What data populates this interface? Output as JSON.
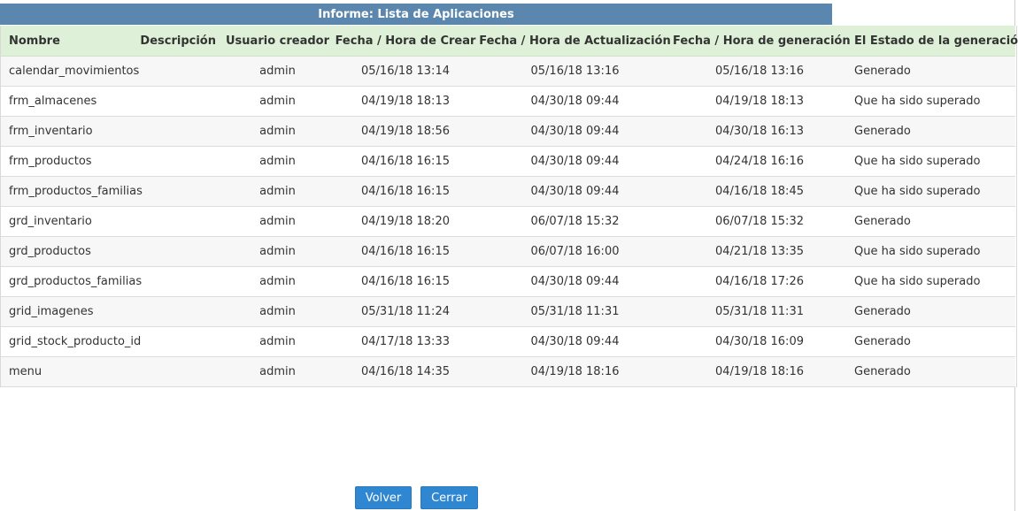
{
  "report": {
    "title": "Informe: Lista de Aplicaciones"
  },
  "table": {
    "headers": [
      "Nombre",
      "Descripción",
      "Usuario creador",
      "Fecha / Hora de Crear",
      "Fecha / Hora de Actualización",
      "Fecha / Hora de generación",
      "El Estado de la generación"
    ],
    "rows": [
      {
        "name": "calendar_movimientos",
        "description": "",
        "user": "admin",
        "created": "05/16/18 13:14",
        "updated": "05/16/18 13:16",
        "generated": "05/16/18 13:16",
        "status": "Generado"
      },
      {
        "name": "frm_almacenes",
        "description": "",
        "user": "admin",
        "created": "04/19/18 18:13",
        "updated": "04/30/18 09:44",
        "generated": "04/19/18 18:13",
        "status": "Que ha sido superado"
      },
      {
        "name": "frm_inventario",
        "description": "",
        "user": "admin",
        "created": "04/19/18 18:56",
        "updated": "04/30/18 09:44",
        "generated": "04/30/18 16:13",
        "status": "Generado"
      },
      {
        "name": "frm_productos",
        "description": "",
        "user": "admin",
        "created": "04/16/18 16:15",
        "updated": "04/30/18 09:44",
        "generated": "04/24/18 16:16",
        "status": "Que ha sido superado"
      },
      {
        "name": "frm_productos_familias",
        "description": "",
        "user": "admin",
        "created": "04/16/18 16:15",
        "updated": "04/30/18 09:44",
        "generated": "04/16/18 18:45",
        "status": "Que ha sido superado"
      },
      {
        "name": "grd_inventario",
        "description": "",
        "user": "admin",
        "created": "04/19/18 18:20",
        "updated": "06/07/18 15:32",
        "generated": "06/07/18 15:32",
        "status": "Generado"
      },
      {
        "name": "grd_productos",
        "description": "",
        "user": "admin",
        "created": "04/16/18 16:15",
        "updated": "06/07/18 16:00",
        "generated": "04/21/18 13:35",
        "status": "Que ha sido superado"
      },
      {
        "name": "grd_productos_familias",
        "description": "",
        "user": "admin",
        "created": "04/16/18 16:15",
        "updated": "04/30/18 09:44",
        "generated": "04/16/18 17:26",
        "status": "Que ha sido superado"
      },
      {
        "name": "grid_imagenes",
        "description": "",
        "user": "admin",
        "created": "05/31/18 11:24",
        "updated": "05/31/18 11:31",
        "generated": "05/31/18 11:31",
        "status": "Generado"
      },
      {
        "name": "grid_stock_producto_id",
        "description": "",
        "user": "admin",
        "created": "04/17/18 13:33",
        "updated": "04/30/18 09:44",
        "generated": "04/30/18 16:09",
        "status": "Generado"
      },
      {
        "name": "menu",
        "description": "",
        "user": "admin",
        "created": "04/16/18 14:35",
        "updated": "04/19/18 18:16",
        "generated": "04/19/18 18:16",
        "status": "Generado"
      }
    ]
  },
  "buttons": {
    "back_label": "Volver",
    "close_label": "Cerrar"
  },
  "colors": {
    "title_bar": "#5b86ad",
    "header_bg": "#dff0d8",
    "button_bg": "#2f86d1"
  }
}
